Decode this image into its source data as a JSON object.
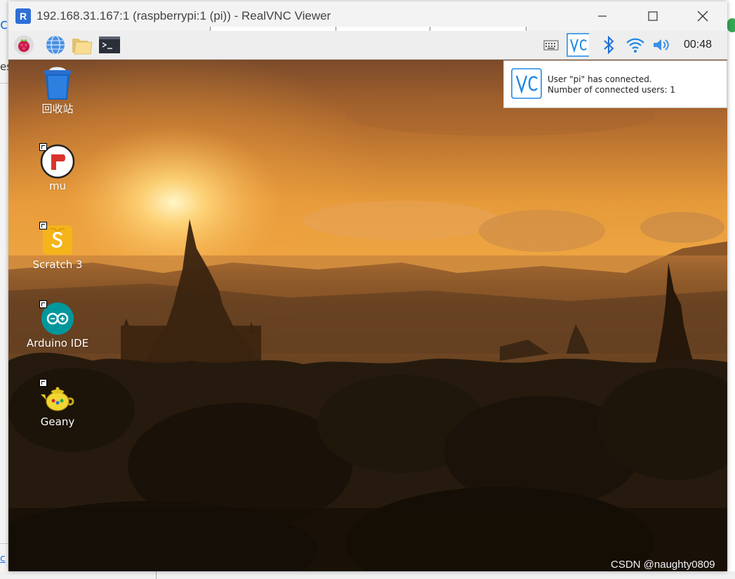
{
  "window": {
    "title": "192.168.31.167:1 (raspberrypi:1 (pi)) - RealVNC Viewer",
    "app_icon_text": "R"
  },
  "host": {
    "left_fragment_1": "c",
    "left_fragment_2": "es",
    "left_fragment_3": "c"
  },
  "panel": {
    "items": [
      {
        "icon": "raspberry-menu-icon"
      },
      {
        "icon": "web-browser-icon"
      },
      {
        "icon": "file-manager-icon"
      },
      {
        "icon": "terminal-icon"
      }
    ],
    "tray": [
      "keyboard-icon",
      "vnc-server-icon",
      "bluetooth-icon",
      "wifi-icon",
      "volume-icon"
    ],
    "clock": "00:48"
  },
  "notification": {
    "line1": "User \"pi\" has connected.",
    "line2": "Number of connected users: 1"
  },
  "desktop_icons": [
    {
      "label": "回收站",
      "icon": "trash-icon"
    },
    {
      "label": "mu",
      "icon": "mu-editor-icon"
    },
    {
      "label": "Scratch 3",
      "icon": "scratch-icon"
    },
    {
      "label": "Arduino IDE",
      "icon": "arduino-icon"
    },
    {
      "label": "Geany",
      "icon": "geany-icon"
    }
  ],
  "watermark": "CSDN @naughty0809",
  "colors": {
    "vnc_blue": "#1e88e5",
    "panel_bg": "#eeeeee",
    "titlebar_bg": "#f3f3f3"
  }
}
